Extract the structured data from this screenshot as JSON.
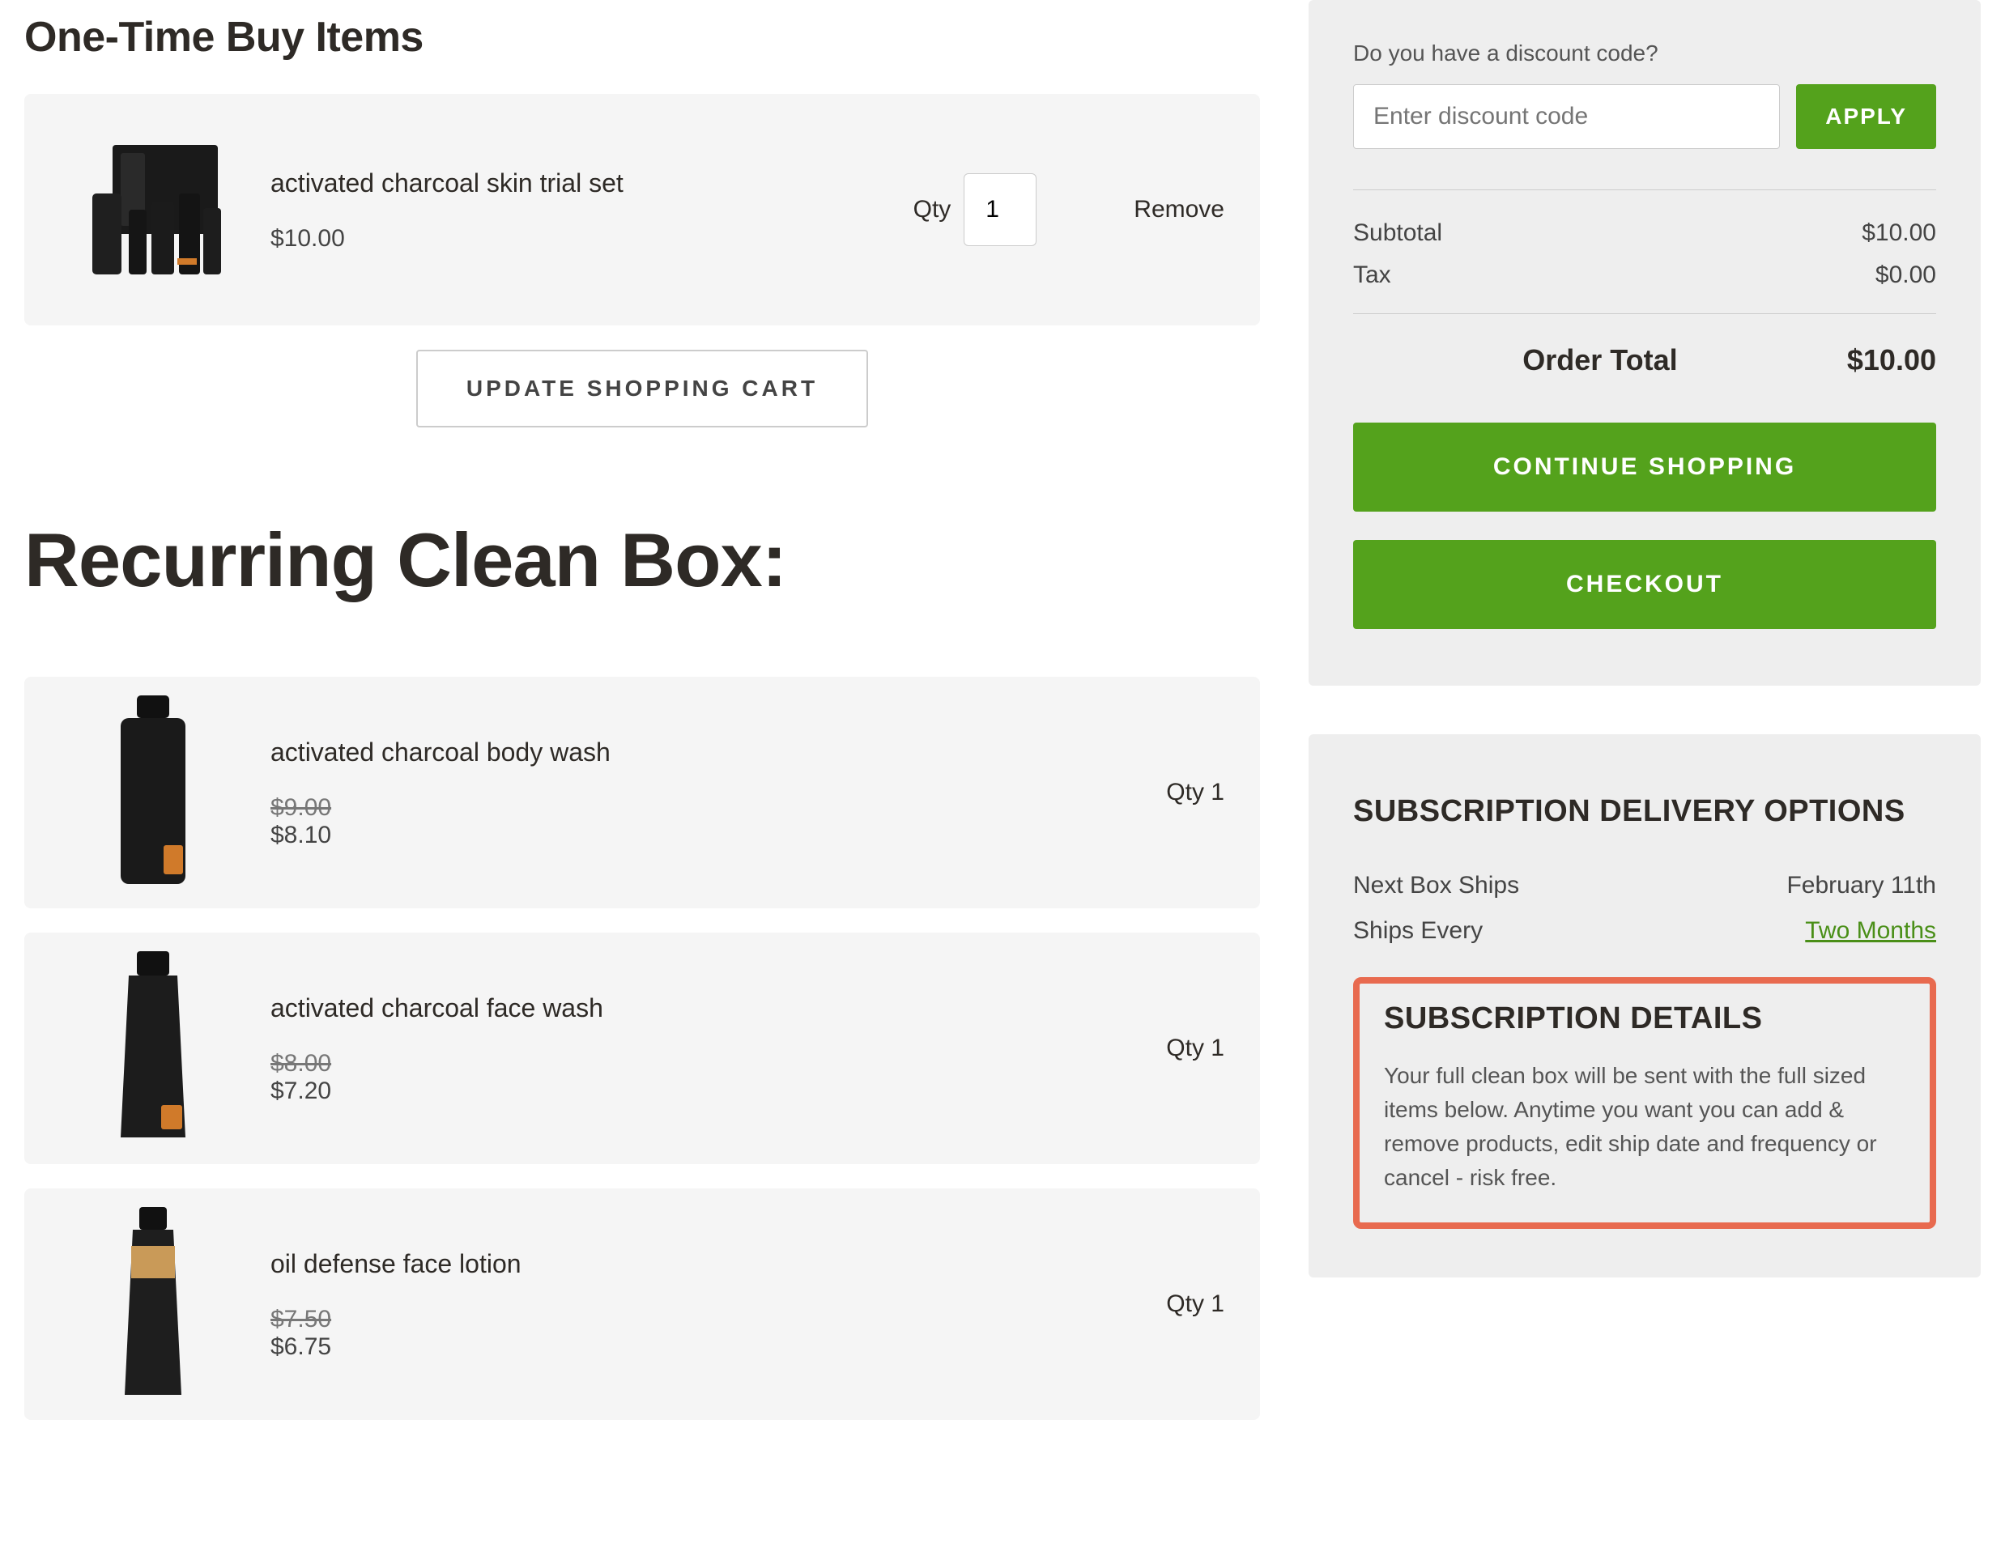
{
  "onetime": {
    "heading": "One-Time Buy Items",
    "item": {
      "name": "activated charcoal skin trial set",
      "price": "$10.00",
      "qty_label": "Qty",
      "qty_value": "1",
      "remove": "Remove"
    },
    "update_btn": "UPDATE SHOPPING CART"
  },
  "recurring": {
    "heading": "Recurring Clean Box:",
    "items": [
      {
        "name": "activated charcoal body wash",
        "orig": "$9.00",
        "disc": "$8.10",
        "qty": "Qty 1"
      },
      {
        "name": "activated charcoal face wash",
        "orig": "$8.00",
        "disc": "$7.20",
        "qty": "Qty 1"
      },
      {
        "name": "oil defense face lotion",
        "orig": "$7.50",
        "disc": "$6.75",
        "qty": "Qty 1"
      }
    ]
  },
  "summary": {
    "discount_q": "Do you have a discount code?",
    "discount_placeholder": "Enter discount code",
    "apply": "APPLY",
    "subtotal_label": "Subtotal",
    "subtotal_value": "$10.00",
    "tax_label": "Tax",
    "tax_value": "$0.00",
    "order_total_label": "Order Total",
    "order_total_value": "$10.00",
    "continue_btn": "CONTINUE SHOPPING",
    "checkout_btn": "CHECKOUT"
  },
  "subscription": {
    "title": "SUBSCRIPTION DELIVERY OPTIONS",
    "next_label": "Next Box Ships",
    "next_value": "February 11th",
    "every_label": "Ships Every",
    "every_value": "Two Months",
    "details_title": "SUBSCRIPTION DETAILS",
    "details_text": "Your full clean box will be sent with the full sized items below. Anytime you want you can add & remove products, edit ship date and frequency or cancel - risk free."
  }
}
